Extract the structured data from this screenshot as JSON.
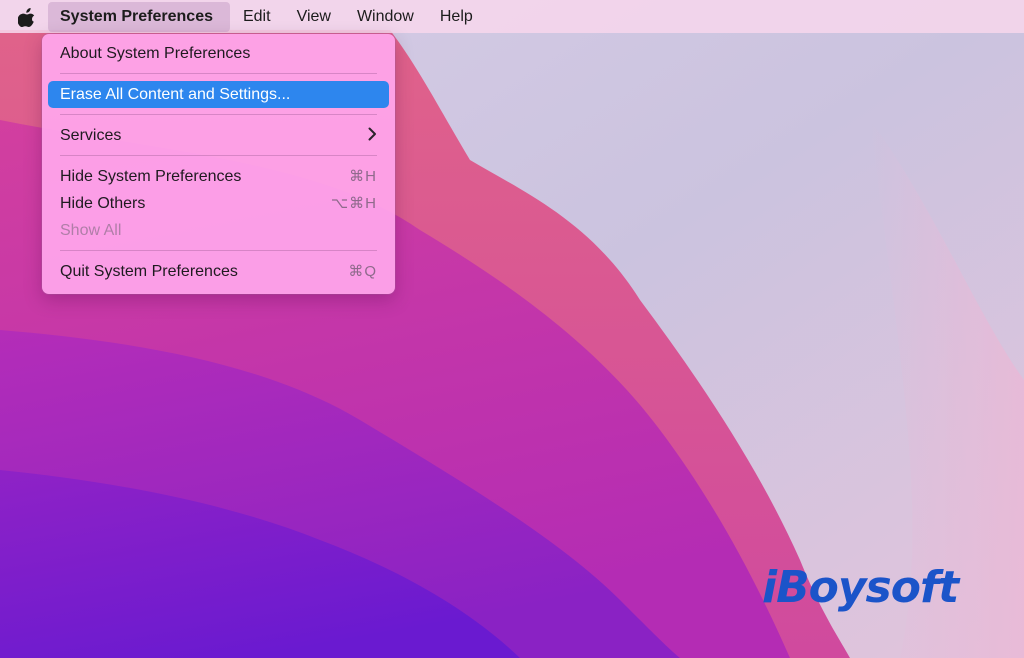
{
  "menubar": {
    "apple_icon": "apple-icon",
    "app_menu": "System Preferences",
    "menus": [
      "Edit",
      "View",
      "Window",
      "Help"
    ]
  },
  "dropdown": {
    "about": "About System Preferences",
    "erase": "Erase All Content and Settings...",
    "services": "Services",
    "services_icon": "chevron-right-icon",
    "hide": "Hide System Preferences",
    "hide_shortcut": "⌘H",
    "hide_others": "Hide Others",
    "hide_others_shortcut": "⌥⌘H",
    "show_all": "Show All",
    "quit": "Quit System Preferences",
    "quit_shortcut": "⌘Q"
  },
  "watermark": {
    "logo": "iBoysoft"
  },
  "colors": {
    "highlight": "#2d86ee",
    "menu_bg": "#ffa6ec",
    "logo": "#1b54c9"
  }
}
